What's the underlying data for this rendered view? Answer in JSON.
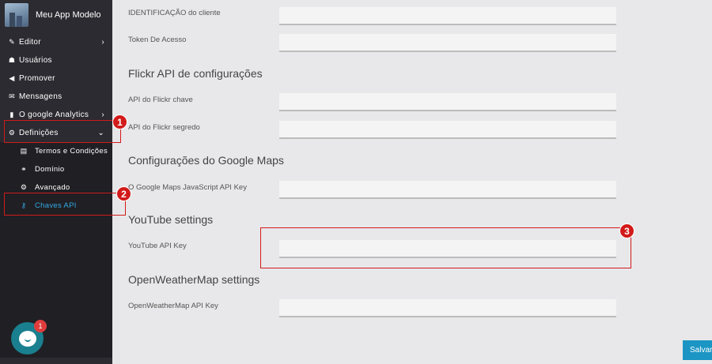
{
  "app": {
    "name": "Meu App Modelo"
  },
  "sidebar": {
    "items": [
      {
        "label": "Editor",
        "icon": "pencil-icon",
        "glyph": "✎",
        "has_chevron": true
      },
      {
        "label": "Usuários",
        "icon": "users-icon",
        "glyph": "☗",
        "has_chevron": false
      },
      {
        "label": "Promover",
        "icon": "megaphone-icon",
        "glyph": "◀",
        "has_chevron": false
      },
      {
        "label": "Mensagens",
        "icon": "envelope-icon",
        "glyph": "✉",
        "has_chevron": false
      },
      {
        "label": "O google Analytics",
        "icon": "bar-chart-icon",
        "glyph": "▮",
        "has_chevron": true
      },
      {
        "label": "Definições",
        "icon": "gears-icon",
        "glyph": "⚙",
        "has_chevron": true
      }
    ],
    "subitems": [
      {
        "label": "Termos e Condições",
        "icon": "document-icon",
        "glyph": "▤"
      },
      {
        "label": "Domínio",
        "icon": "link-icon",
        "glyph": "⚭"
      },
      {
        "label": "Avançado",
        "icon": "cogs-icon",
        "glyph": "⚙"
      },
      {
        "label": "Chaves API",
        "icon": "key-icon",
        "glyph": "⚷",
        "active": true
      }
    ],
    "chat_badge": "1"
  },
  "main": {
    "fields_top": [
      {
        "label": "IDENTIFICAÇÃO do cliente",
        "value": ""
      },
      {
        "label": "Token De Acesso",
        "value": ""
      }
    ],
    "sections": [
      {
        "title": "Flickr API de configurações",
        "fields": [
          {
            "label": "API do Flickr chave",
            "value": ""
          },
          {
            "label": "API do Flickr segredo",
            "value": ""
          }
        ]
      },
      {
        "title": "Configurações do Google Maps",
        "fields": [
          {
            "label": "O Google Maps JavaScript API Key",
            "value": ""
          }
        ]
      },
      {
        "title": "YouTube settings",
        "fields": [
          {
            "label": "YouTube API Key",
            "value": ""
          }
        ]
      },
      {
        "title": "OpenWeatherMap settings",
        "fields": [
          {
            "label": "OpenWeatherMap API Key",
            "value": ""
          }
        ]
      }
    ],
    "save_label": "Salvar"
  },
  "annotations": [
    "1",
    "2",
    "3"
  ],
  "colors": {
    "accent": "#36a9e1",
    "annotation": "#d21a1a",
    "sidebar_bg": "#2b2b31",
    "save_button": "#1b95c4"
  }
}
